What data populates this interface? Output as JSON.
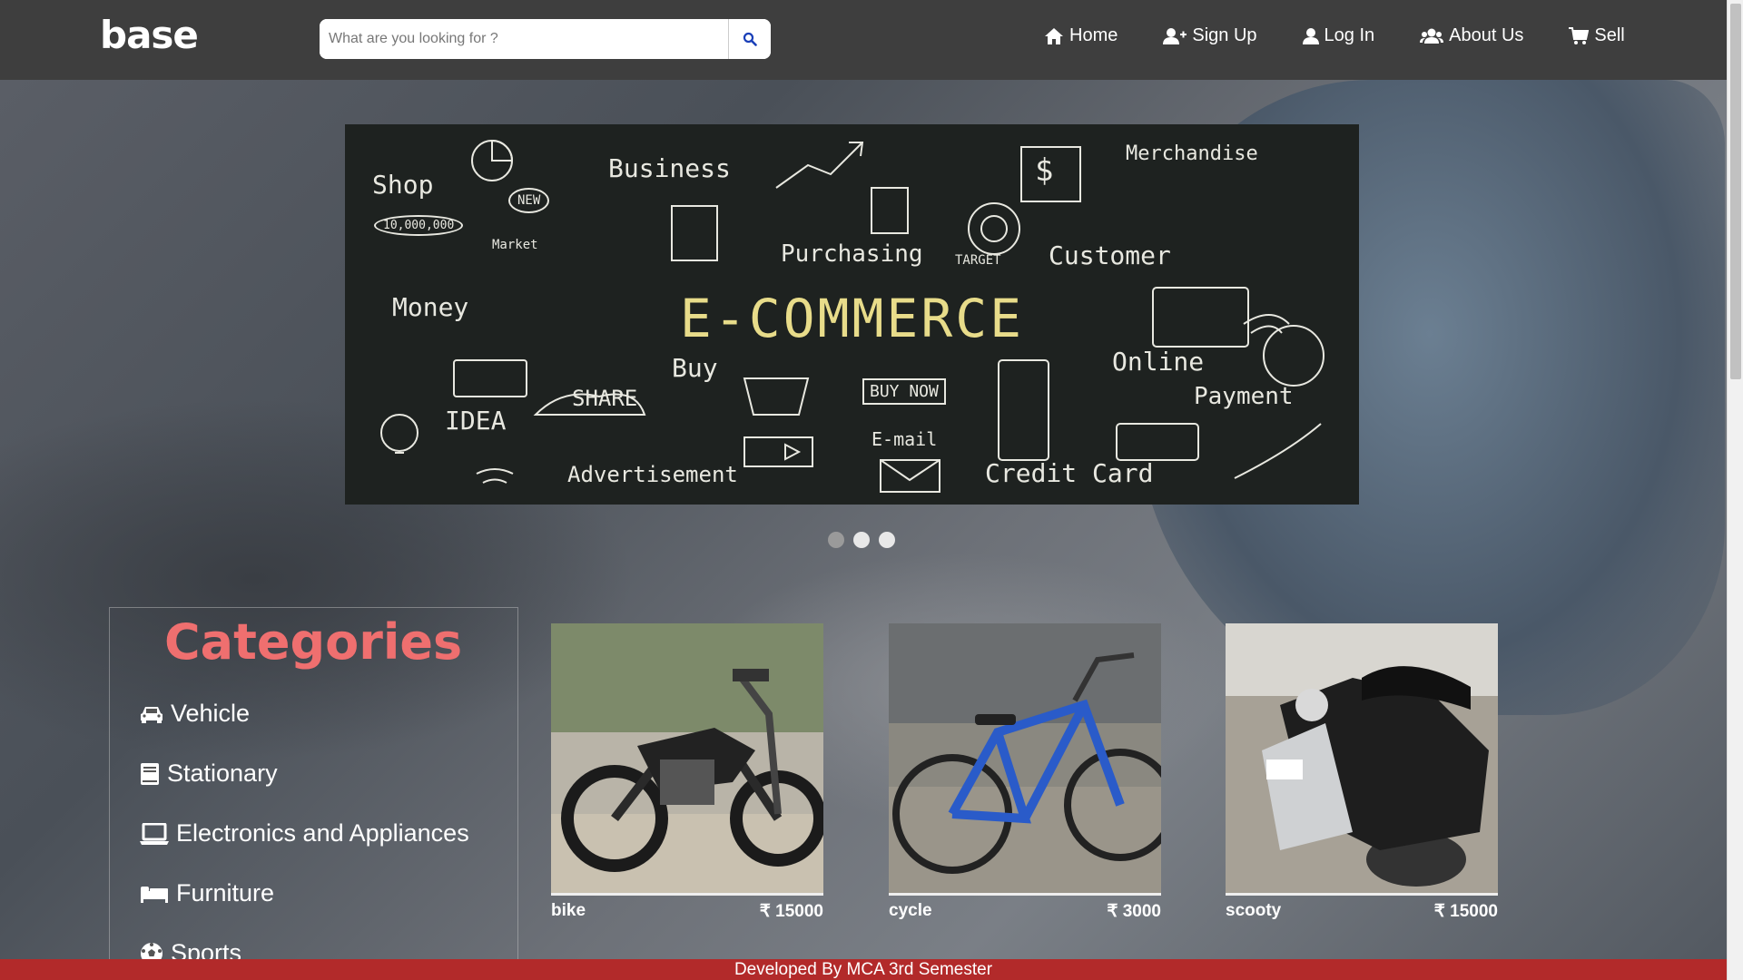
{
  "brand": {
    "logo_text": "base"
  },
  "search": {
    "placeholder": "What are you looking for ?"
  },
  "nav": {
    "home": "Home",
    "signup": "Sign Up",
    "login": "Log In",
    "about": "About Us",
    "sell": "Sell"
  },
  "carousel": {
    "banner_heading": "E-COMMERCE",
    "chalk_words": [
      "Shop",
      "Business",
      "Merchandise",
      "Purchasing",
      "Customer",
      "Money",
      "Buy",
      "Online",
      "Payment",
      "IDEA",
      "SHARE",
      "BUY NOW",
      "E-mail",
      "Advertisement",
      "Credit Card",
      "NEW",
      "Market",
      "TARGET",
      "10,000,000"
    ],
    "slide_count": 3,
    "active_slide": 0
  },
  "categories": {
    "title": "Categories",
    "items": [
      {
        "label": "Vehicle",
        "icon": "car-icon"
      },
      {
        "label": "Stationary",
        "icon": "book-icon"
      },
      {
        "label": "Electronics and Appliances",
        "icon": "laptop-icon"
      },
      {
        "label": "Furniture",
        "icon": "bed-icon"
      },
      {
        "label": "Sports",
        "icon": "football-icon"
      }
    ]
  },
  "products": [
    {
      "name": "bike",
      "price": "₹ 15000"
    },
    {
      "name": "cycle",
      "price": "₹ 3000"
    },
    {
      "name": "scooty",
      "price": "₹ 15000"
    }
  ],
  "footer": {
    "text": "Developed By MCA 3rd Semester"
  },
  "colors": {
    "navbar": "#3e3e3e",
    "accent_title": "#ef6f6f",
    "footer": "#b22a2a",
    "search_icon": "#1a3fb8"
  }
}
